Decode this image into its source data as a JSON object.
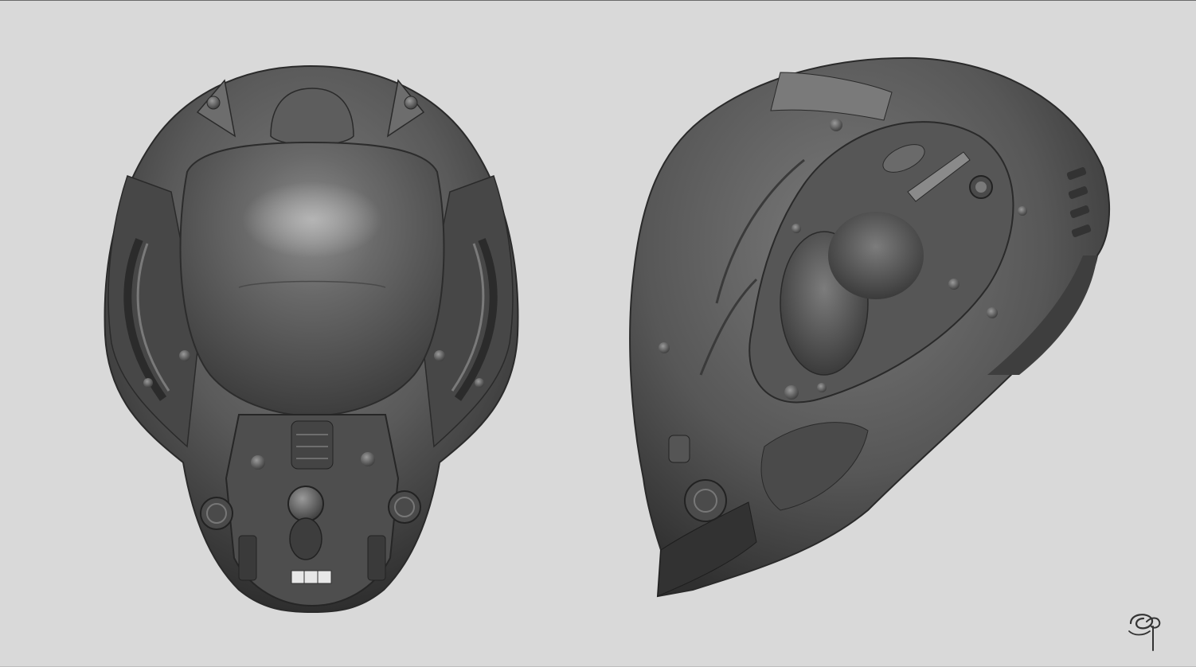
{
  "scene": {
    "background_color": "#d9d9d9",
    "material_color": "#5e5e5e",
    "views": [
      {
        "id": "front",
        "description_name": "helmet-front-view"
      },
      {
        "id": "side",
        "description_name": "helmet-side-view"
      }
    ]
  },
  "signature": {
    "icon": "artist-signature-icon",
    "color": "#333333"
  }
}
